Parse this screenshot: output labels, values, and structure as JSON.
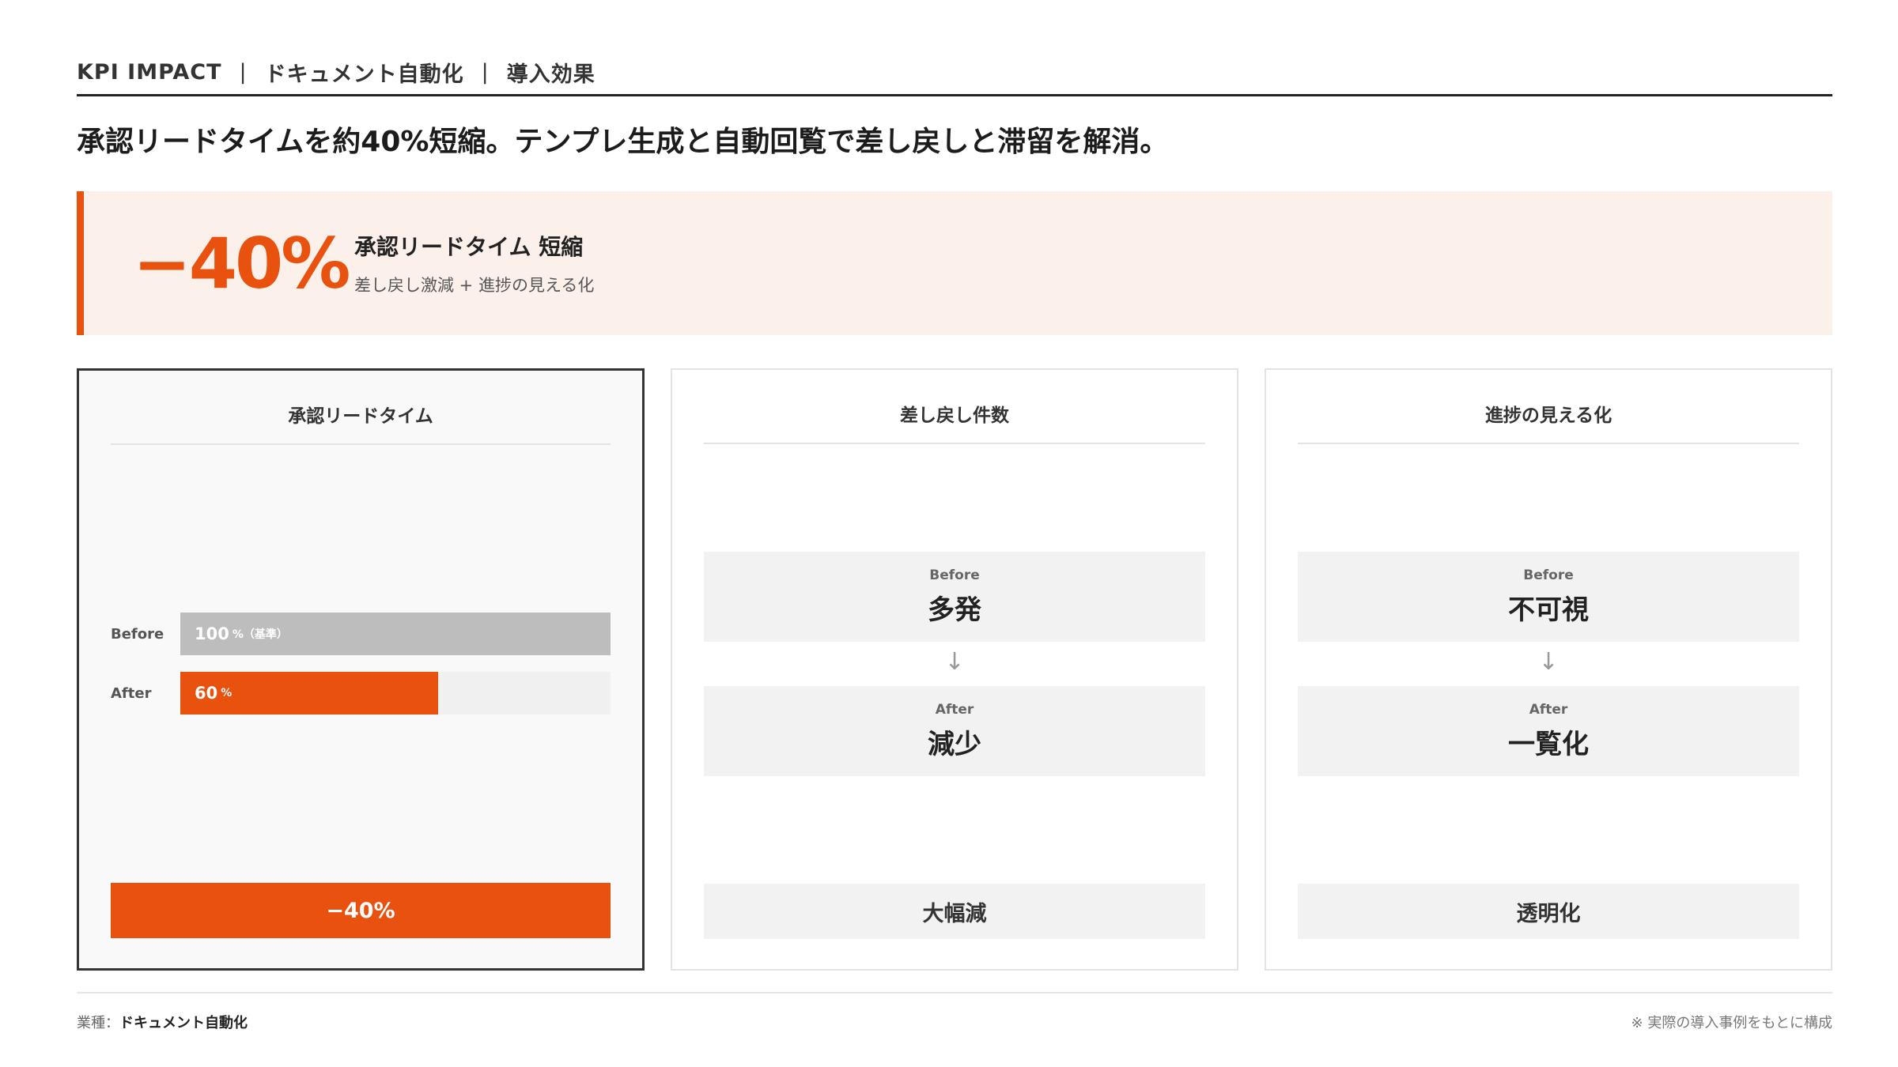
{
  "header": {
    "crumbs": [
      "KPI IMPACT",
      "ドキュメント自動化",
      "導入効果"
    ],
    "separator": "|"
  },
  "headline": "承認リードタイムを約40%短縮。テンプレ生成と自動回覧で差し戻しと滞留を解消。",
  "hero": {
    "value": "−40%",
    "title": "承認リードタイム 短縮",
    "subtitle": "差し戻し激減 + 進捗の見える化"
  },
  "cards": {
    "leadtime": {
      "title": "承認リードタイム",
      "before_label": "Before",
      "before_value": "100",
      "before_unit": "%（基準）",
      "before_fraction": 1.0,
      "after_label": "After",
      "after_value": "60",
      "after_unit": "%",
      "after_fraction": 0.6,
      "result": "−40%"
    },
    "remand": {
      "title": "差し戻し件数",
      "before_label": "Before",
      "before_value": "多発",
      "arrow": "↓",
      "after_label": "After",
      "after_value": "減少",
      "result": "大幅減"
    },
    "visibility": {
      "title": "進捗の見える化",
      "before_label": "Before",
      "before_value": "不可視",
      "arrow": "↓",
      "after_label": "After",
      "after_value": "一覧化",
      "result": "透明化"
    }
  },
  "footer": {
    "industry_label": "業種：",
    "industry_value": "ドキュメント自動化",
    "note": "※ 実際の導入事例をもとに構成"
  },
  "colors": {
    "accent": "#e8510e",
    "hero_bg": "#fcf0eb",
    "bar_gray": "#bdbdbd"
  }
}
